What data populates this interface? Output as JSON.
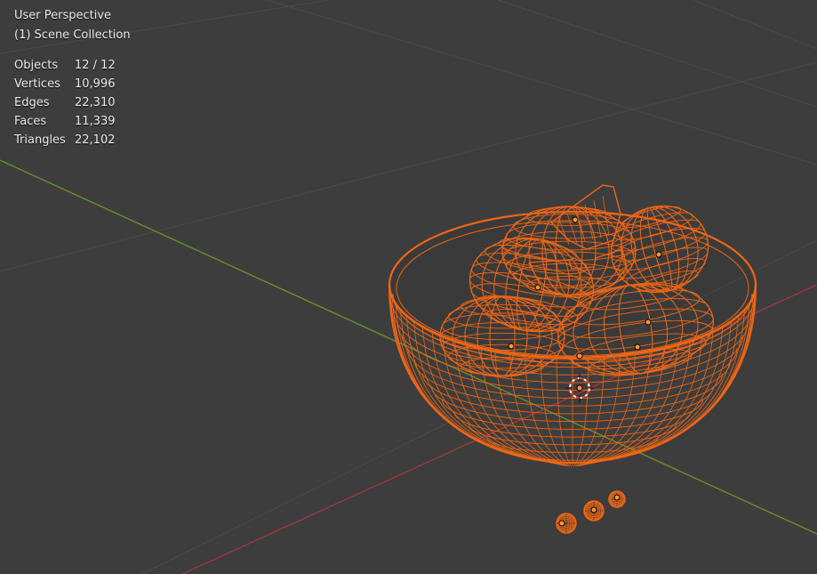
{
  "viewport": {
    "view_name": "User Perspective",
    "collection": "(1) Scene Collection"
  },
  "stats": [
    {
      "label": "Objects",
      "value": "12 / 12"
    },
    {
      "label": "Vertices",
      "value": "10,996"
    },
    {
      "label": "Edges",
      "value": "22,310"
    },
    {
      "label": "Faces",
      "value": "11,339"
    },
    {
      "label": "Triangles",
      "value": "22,102"
    }
  ],
  "colors": {
    "background": "#3d3d3d",
    "grid": "#4a4a4a",
    "x_axis": "#9c3a3e",
    "y_axis": "#6a8f2b",
    "selection_wire": "#ee6614",
    "origin_dot": "#ff9a2e"
  },
  "icons": [
    "3d-cursor-icon"
  ]
}
